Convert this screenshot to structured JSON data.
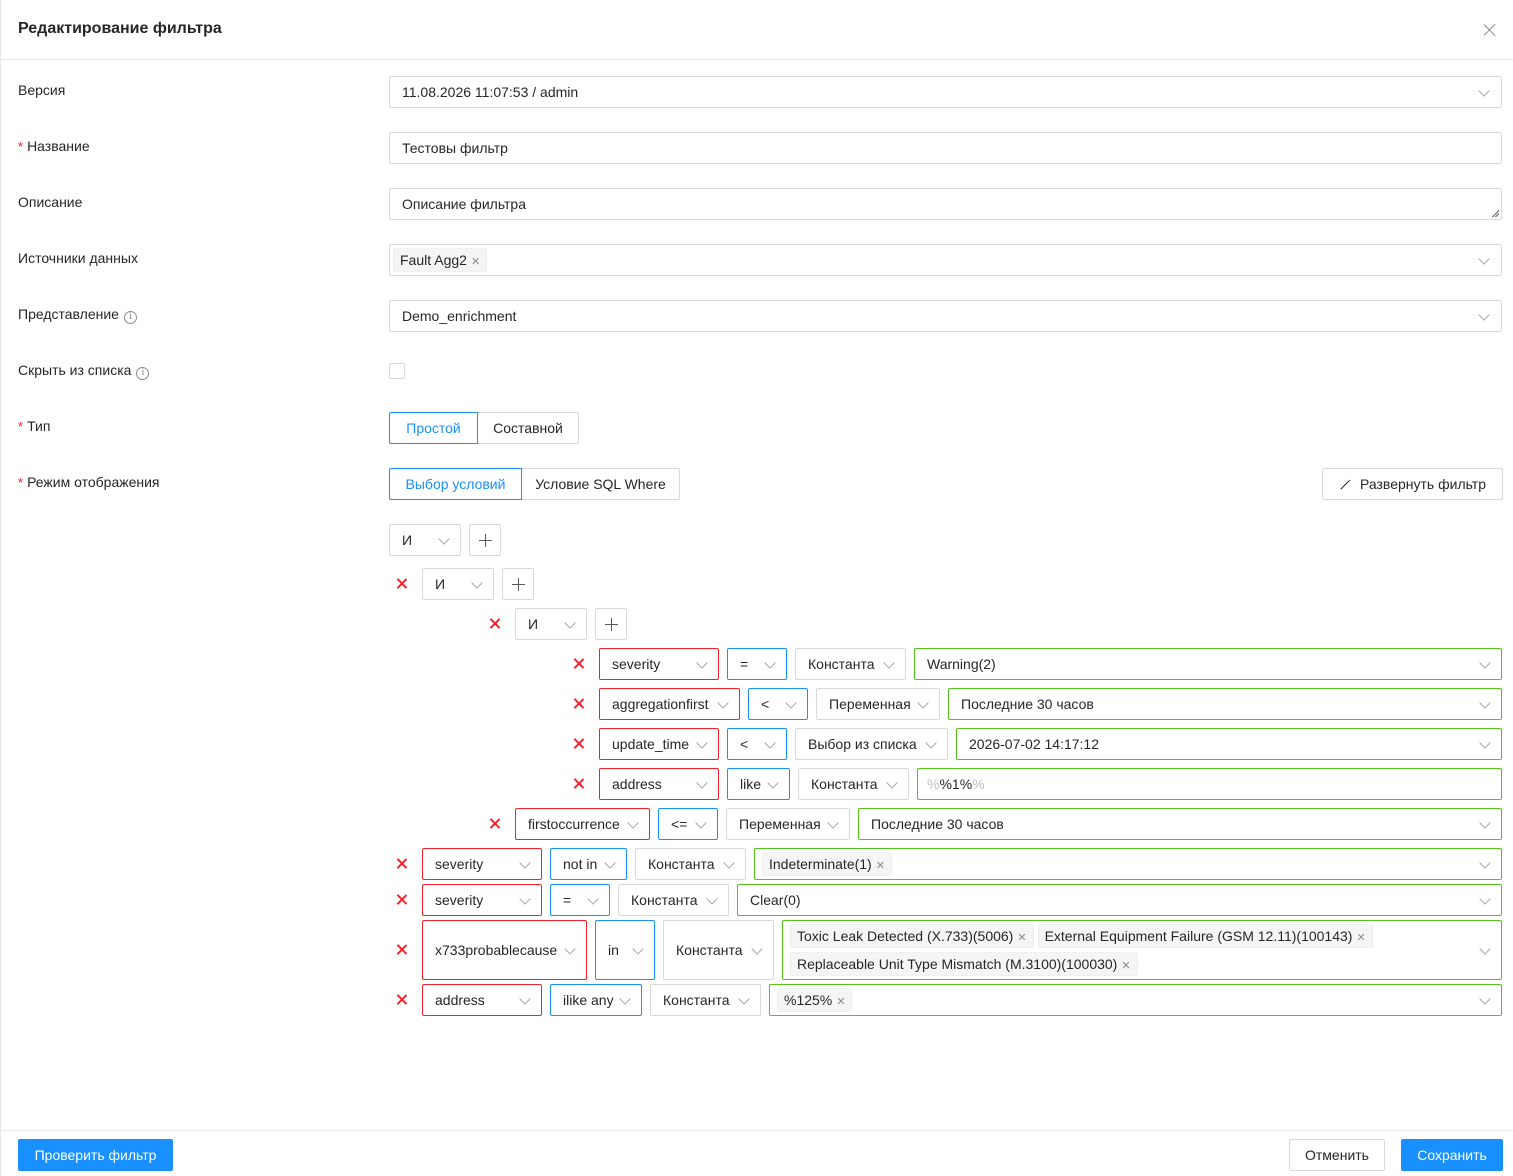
{
  "dialog": {
    "title": "Редактирование фильтра"
  },
  "form": {
    "version": {
      "label": "Версия",
      "value": "11.08.2026 11:07:53 / admin"
    },
    "name": {
      "label": "Название",
      "value": "Тестовы фильтр"
    },
    "description": {
      "label": "Описание",
      "value": "Описание фильтра"
    },
    "sources": {
      "label": "Источники данных",
      "tags": [
        "Fault Agg2"
      ]
    },
    "view": {
      "label": "Представление",
      "value": "Demo_enrichment"
    },
    "hide": {
      "label": "Скрыть из списка",
      "checked": false
    },
    "type": {
      "label": "Тип",
      "options": [
        "Простой",
        "Составной"
      ],
      "selected": "Простой"
    },
    "mode": {
      "label": "Режим отображения",
      "options": [
        "Выбор условий",
        "Условие SQL Where"
      ],
      "selected": "Выбор условий"
    },
    "expand_label": "Развернуть фильтр"
  },
  "builder": {
    "root_op": "И",
    "group1_op": "И",
    "group2_op": "И",
    "c1": {
      "field": "severity",
      "op": "=",
      "kind": "Константа",
      "value": "Warning(2)"
    },
    "c2": {
      "field": "aggregationfirst",
      "op": "<",
      "kind": "Переменная",
      "value": "Последние 30 часов"
    },
    "c3": {
      "field": "update_time",
      "op": "<",
      "kind": "Выбор из списка",
      "value": "2026-07-02 14:17:12"
    },
    "c4": {
      "field": "address",
      "op": "like",
      "kind": "Константа",
      "value_prefix": "%",
      "value": "%1%",
      "value_suffix": "%"
    },
    "c5": {
      "field": "firstoccurrence",
      "op": "<=",
      "kind": "Переменная",
      "value": "Последние 30 часов"
    },
    "c6": {
      "field": "severity",
      "op": "not in",
      "kind": "Константа",
      "tags": [
        "Indeterminate(1)"
      ]
    },
    "c7": {
      "field": "severity",
      "op": "=",
      "kind": "Константа",
      "value": "Clear(0)"
    },
    "c8": {
      "field": "x733probablecause",
      "op": "in",
      "kind": "Константа",
      "tags": [
        "Toxic Leak Detected (X.733)(5006)",
        "External Equipment Failure (GSM 12.11)(100143)",
        "Replaceable Unit Type Mismatch (M.3100)(100030)"
      ]
    },
    "c9": {
      "field": "address",
      "op": "ilike any",
      "kind": "Константа",
      "tags": [
        "%125%"
      ]
    }
  },
  "footer": {
    "check_label": "Проверить фильтр",
    "cancel_label": "Отменить",
    "save_label": "Сохранить"
  },
  "colors": {
    "primary": "#1890ff",
    "danger": "#f5222d",
    "success": "#52c41a",
    "border": "#d9d9d9"
  },
  "icons": [
    "close-icon",
    "chevron-down-icon",
    "info-icon",
    "expand-icon",
    "plus-icon",
    "delete-icon",
    "tag-close-icon",
    "resize-handle-icon"
  ]
}
